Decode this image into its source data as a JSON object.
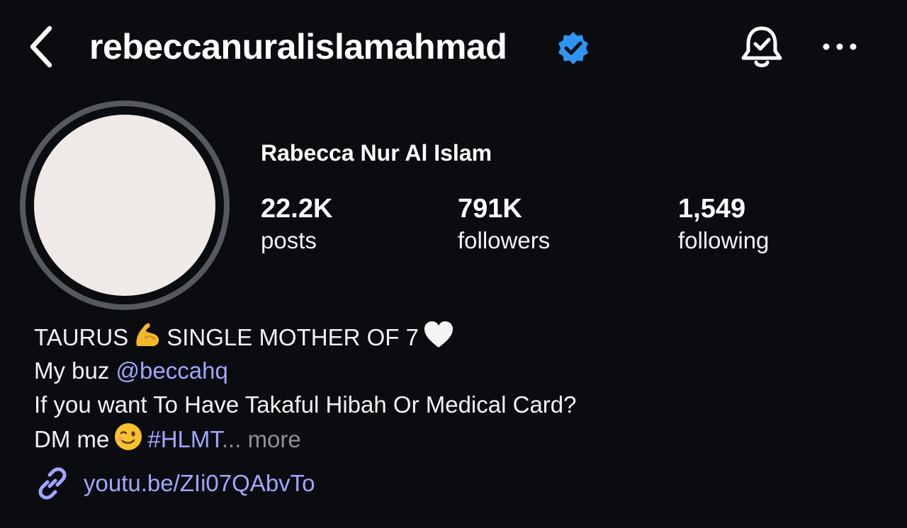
{
  "header": {
    "username": "rebeccanuralislamahmad",
    "verified": true,
    "icons": {
      "back": "chevron-left-icon",
      "verified": "verified-badge-icon",
      "notifications": "bell-check-icon",
      "more": "more-horizontal-icon"
    }
  },
  "profile": {
    "full_name": "Rabecca Nur Al Islam",
    "stats": [
      {
        "value": "22.2K",
        "label": "posts"
      },
      {
        "value": "791K",
        "label": "followers"
      },
      {
        "value": "1,549",
        "label": "following"
      }
    ]
  },
  "bio": {
    "line1_a": "TAURUS",
    "line1_b": "SINGLE MOTHER OF 7",
    "line2_prefix": "My buz ",
    "line2_mention": "@beccahq",
    "line3": "If you want To Have Takaful Hibah Or Medical Card?",
    "line4_prefix": "DM me",
    "line4_hashtag": "#HLMT",
    "line4_ellipsis": "...",
    "line4_more": "more",
    "emojis": [
      "flexed-biceps-emoji",
      "white-heart-emoji",
      "winking-face-emoji"
    ]
  },
  "link": {
    "icon": "link-icon",
    "text": "youtu.be/ZIi07QAbvTo"
  },
  "colors": {
    "background": "#0b0c10",
    "text": "#ffffff",
    "accent_link": "#a2a6ff",
    "verified_blue": "#2f95f5",
    "muted": "#8e9096"
  }
}
